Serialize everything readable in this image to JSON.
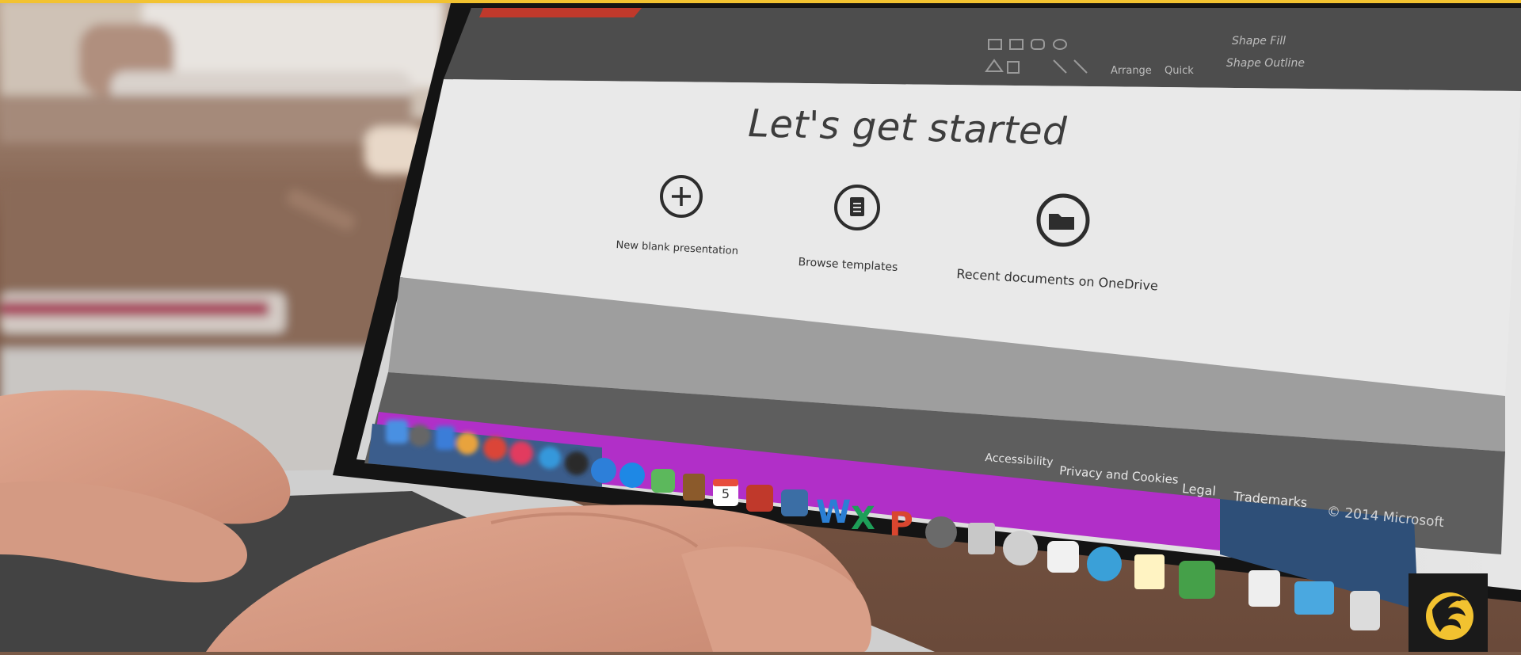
{
  "screen": {
    "title": "Let's get started",
    "options": [
      {
        "label": "New blank presentation",
        "icon": "plus-circle-icon"
      },
      {
        "label": "Browse templates",
        "icon": "document-circle-icon"
      },
      {
        "label": "Recent documents on OneDrive",
        "icon": "folder-circle-icon"
      }
    ],
    "ribbon": {
      "shape_fill": "Shape Fill",
      "shape_outline": "Shape Outline",
      "arrange": "Arrange",
      "quick": "Quick"
    },
    "footer": {
      "accessibility": "Accessibility",
      "privacy": "Privacy and Cookies",
      "legal": "Legal",
      "trademarks": "Trademarks",
      "copyright": "© 2014 Microsoft"
    },
    "calendar_day": "5"
  },
  "colors": {
    "accent": "#f2c230",
    "dock": "#b12fc8",
    "powerpoint": "#c0392b"
  }
}
